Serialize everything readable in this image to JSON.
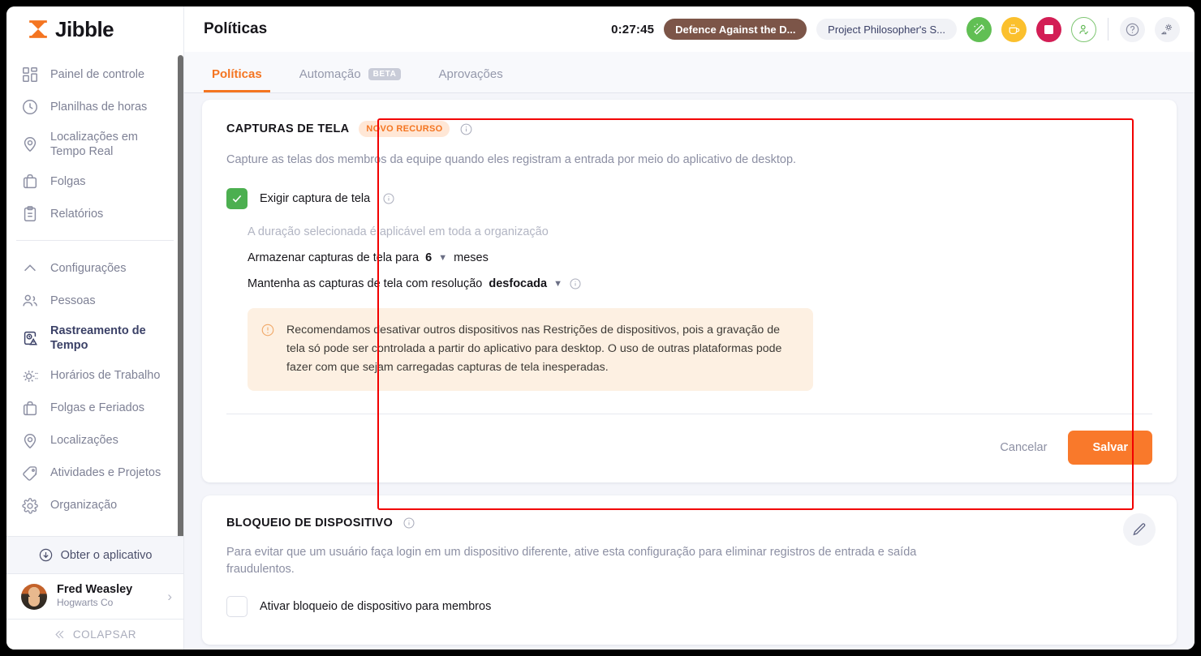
{
  "brand": {
    "name": "Jibble",
    "accent": "#f47521"
  },
  "sidebar": {
    "items_top": [
      {
        "label": "Painel de controle",
        "icon": "dashboard-icon"
      },
      {
        "label": "Planilhas de horas",
        "icon": "clock-icon"
      },
      {
        "label": "Localizações em Tempo Real",
        "icon": "location-pin-icon"
      },
      {
        "label": "Folgas",
        "icon": "briefcase-icon"
      },
      {
        "label": "Relatórios",
        "icon": "clipboard-icon"
      }
    ],
    "settings_label": "Configurações",
    "items_bottom": [
      {
        "label": "Pessoas",
        "icon": "people-icon",
        "active": false
      },
      {
        "label": "Rastreamento de Tempo",
        "icon": "time-tracking-icon",
        "active": true
      },
      {
        "label": "Horários de Trabalho",
        "icon": "schedule-icon",
        "active": false
      },
      {
        "label": "Folgas e Feriados",
        "icon": "briefcase-icon",
        "active": false
      },
      {
        "label": "Localizações",
        "icon": "location-pin-icon",
        "active": false
      },
      {
        "label": "Atividades e Projetos",
        "icon": "tag-icon",
        "active": false
      },
      {
        "label": "Organização",
        "icon": "gear-icon",
        "active": false
      }
    ],
    "get_app": "Obter o aplicativo",
    "profile": {
      "name": "Fred Weasley",
      "org": "Hogwarts Co"
    },
    "collapse": "COLAPSAR"
  },
  "topbar": {
    "title": "Políticas",
    "timer": "0:27:45",
    "activity_pill": "Defence Against the D...",
    "project_pill": "Project Philosopher's S...",
    "buttons": [
      {
        "name": "start-tracking-button",
        "color": "#61bf54"
      },
      {
        "name": "break-button",
        "color": "#fbc02d"
      },
      {
        "name": "stop-button",
        "color": "#d31e55"
      },
      {
        "name": "attendance-button",
        "color": "#7ec672"
      }
    ],
    "help_icon": "help-icon",
    "settings_icon": "settings-gear-icon"
  },
  "tabs": [
    {
      "label": "Políticas",
      "badge": null,
      "active": true
    },
    {
      "label": "Automação",
      "badge": "BETA",
      "active": false
    },
    {
      "label": "Aprovações",
      "badge": null,
      "active": false
    }
  ],
  "screenshots_card": {
    "title": "CAPTURAS DE TELA",
    "badge": "NOVO RECURSO",
    "description": "Capture as telas dos membros da equipe quando eles registram a entrada por meio do aplicativo de desktop.",
    "checkbox_label": "Exigir captura de tela",
    "checkbox_checked": true,
    "org_note": "A duração selecionada é aplicável em toda a organização",
    "retention_prefix": "Armazenar capturas de tela para",
    "retention_value": "6",
    "retention_suffix": "meses",
    "resolution_prefix": "Mantenha as capturas de tela com resolução",
    "resolution_value": "desfocada",
    "notice": "Recomendamos desativar outros dispositivos nas Restrições de dispositivos, pois a gravação de tela só pode ser controlada a partir do aplicativo para desktop. O uso de outras plataformas pode fazer com que sejam carregadas capturas de tela inesperadas.",
    "cancel_label": "Cancelar",
    "save_label": "Salvar"
  },
  "device_lock_card": {
    "title": "BLOQUEIO DE DISPOSITIVO",
    "description": "Para evitar que um usuário faça login em um dispositivo diferente, ative esta configuração para eliminar registros de entrada e saída fraudulentos.",
    "checkbox_label": "Ativar bloqueio de dispositivo para membros",
    "checkbox_checked": false
  }
}
